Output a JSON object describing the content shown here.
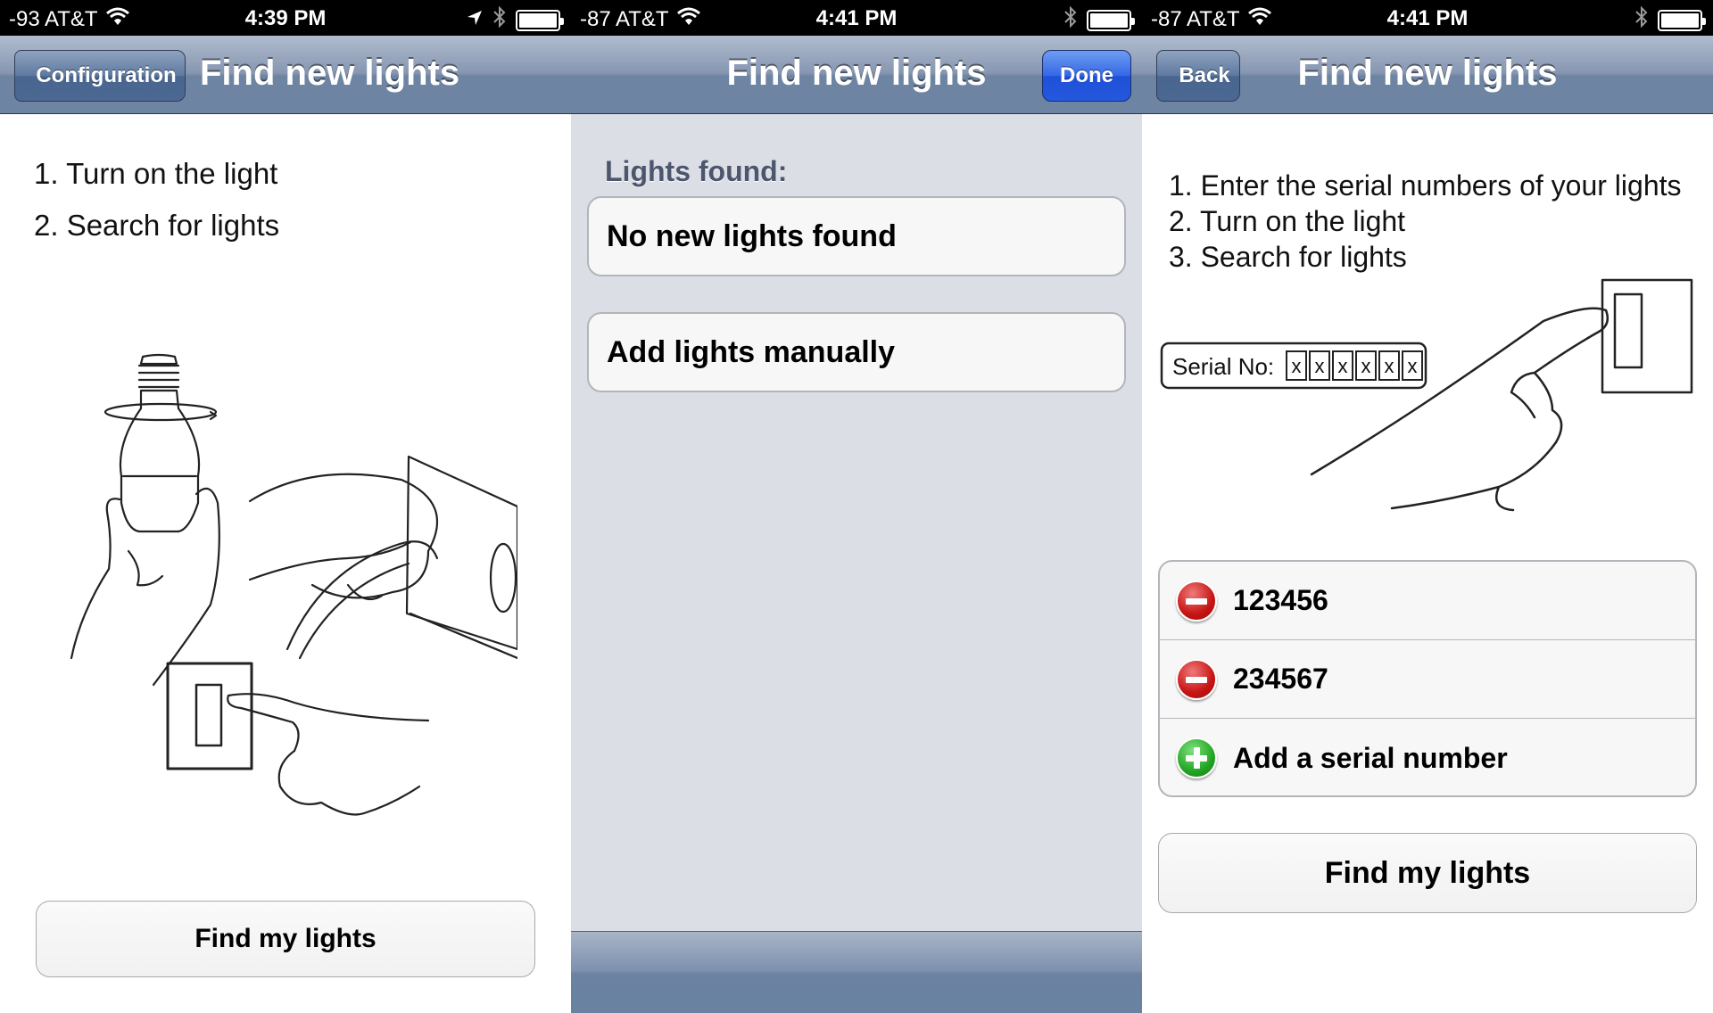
{
  "screens": [
    {
      "status": {
        "carrier": "-93 AT&T",
        "time": "4:39 PM"
      },
      "nav": {
        "back_label": "Configuration",
        "title": "Find new lights"
      },
      "steps": [
        "1. Turn on the light",
        "2. Search for lights"
      ],
      "find_button_label": "Find my lights"
    },
    {
      "status": {
        "carrier": "-87 AT&T",
        "time": "4:41 PM"
      },
      "nav": {
        "title": "Find new lights",
        "done_label": "Done"
      },
      "section_header": "Lights found:",
      "found_cell_label": "No new lights found",
      "add_manually_label": "Add lights manually"
    },
    {
      "status": {
        "carrier": "-87 AT&T",
        "time": "4:41 PM"
      },
      "nav": {
        "back_label": "Back",
        "title": "Find new lights"
      },
      "steps": [
        "1. Enter the serial numbers of your lights",
        "2. Turn on the light",
        "3. Search for lights"
      ],
      "illustration": {
        "serial_label": "Serial No:",
        "serial_boxes": [
          "x",
          "x",
          "x",
          "x",
          "x",
          "x"
        ]
      },
      "serial_rows": [
        {
          "action": "remove",
          "value": "123456"
        },
        {
          "action": "remove",
          "value": "234567"
        },
        {
          "action": "add",
          "value": "Add a serial number"
        }
      ],
      "find_button_label": "Find my lights"
    }
  ],
  "colors": {
    "navbar": "#6d84a2",
    "done_button": "#2458dd",
    "grouped_background": "#dbdee5",
    "remove_icon": "#c71414",
    "add_icon": "#22a622"
  },
  "icons": [
    "wifi-icon",
    "location-arrow-icon",
    "bluetooth-icon",
    "battery-icon",
    "remove-circle-icon",
    "add-circle-icon"
  ]
}
